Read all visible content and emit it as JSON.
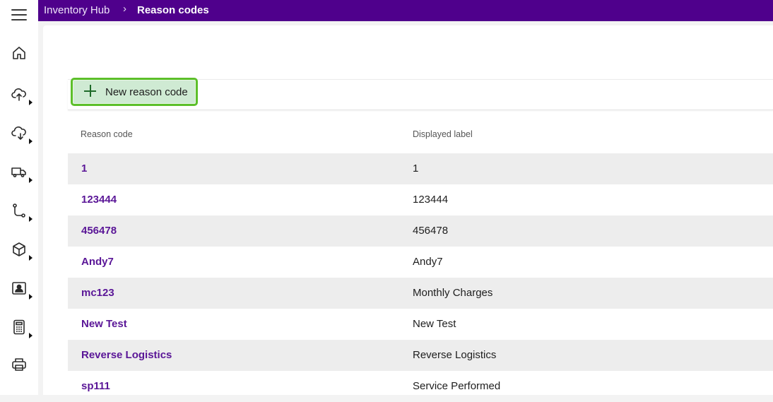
{
  "breadcrumb": {
    "root": "Inventory Hub",
    "separator": "›",
    "current": "Reason codes"
  },
  "toolbar": {
    "new_button_label": "New reason code"
  },
  "table": {
    "columns": [
      "Reason code",
      "Displayed label"
    ],
    "rows": [
      {
        "code": "1",
        "label": "1"
      },
      {
        "code": "123444",
        "label": "123444"
      },
      {
        "code": "456478",
        "label": "456478"
      },
      {
        "code": "Andy7",
        "label": "Andy7"
      },
      {
        "code": "mc123",
        "label": "Monthly Charges"
      },
      {
        "code": "New Test",
        "label": "New Test"
      },
      {
        "code": "Reverse Logistics",
        "label": "Reverse Logistics"
      },
      {
        "code": "sp111",
        "label": "Service Performed"
      }
    ]
  },
  "sidebar": {
    "items": [
      {
        "icon": "home-icon"
      },
      {
        "icon": "upload-cloud-icon"
      },
      {
        "icon": "download-cloud-icon"
      },
      {
        "icon": "truck-icon"
      },
      {
        "icon": "workflow-icon"
      },
      {
        "icon": "package-icon"
      },
      {
        "icon": "contact-card-icon"
      },
      {
        "icon": "calculator-icon"
      },
      {
        "icon": "printer-icon"
      }
    ]
  },
  "colors": {
    "topbar": "#4f008c",
    "link": "#5a1697",
    "button_bg": "#cfead3",
    "button_highlight": "#5cbf2a"
  }
}
